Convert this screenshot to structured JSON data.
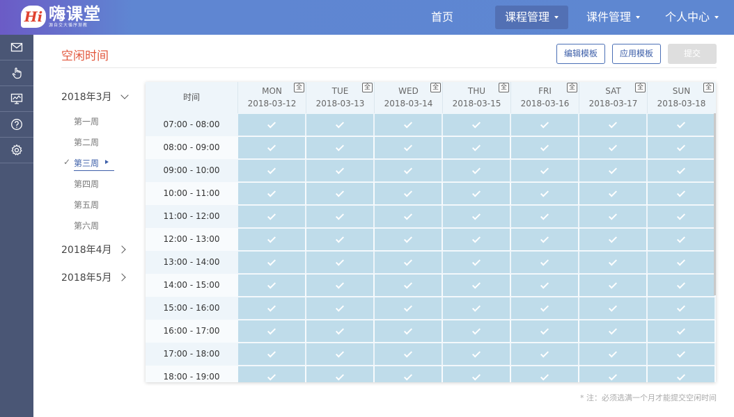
{
  "logo": {
    "badge": "Hi",
    "title": "嗨课堂",
    "subtitle": "源自交大循序渐教"
  },
  "nav": {
    "home": "首页",
    "course": "课程管理",
    "courseware": "课件管理",
    "personal": "个人中心"
  },
  "sidebar": {
    "items": [
      {
        "icon": "mail-icon"
      },
      {
        "icon": "hand-pointer-icon"
      },
      {
        "icon": "monitor-chart-icon"
      },
      {
        "icon": "help-icon"
      },
      {
        "icon": "settings-icon"
      }
    ]
  },
  "page": {
    "title": "空闲时间",
    "edit_template": "编辑模板",
    "apply_template": "应用模板",
    "submit": "提交",
    "note": "* 注：必须选满一个月才能提交空闲时间"
  },
  "months": [
    {
      "label": "2018年3月",
      "expanded": true
    },
    {
      "label": "2018年4月",
      "expanded": false
    },
    {
      "label": "2018年5月",
      "expanded": false
    }
  ],
  "weeks": [
    "第一周",
    "第二周",
    "第三周",
    "第四周",
    "第五周",
    "第六周"
  ],
  "week_check": "✓",
  "active_week_index": 2,
  "table": {
    "time_header": "时间",
    "all_label": "全",
    "days": [
      {
        "name": "MON",
        "date": "2018-03-12"
      },
      {
        "name": "TUE",
        "date": "2018-03-13"
      },
      {
        "name": "WED",
        "date": "2018-03-14"
      },
      {
        "name": "THU",
        "date": "2018-03-15"
      },
      {
        "name": "FRI",
        "date": "2018-03-16"
      },
      {
        "name": "SAT",
        "date": "2018-03-17"
      },
      {
        "name": "SUN",
        "date": "2018-03-18"
      }
    ],
    "slots": [
      "07:00 - 08:00",
      "08:00 - 09:00",
      "09:00 - 10:00",
      "10:00 - 11:00",
      "11:00 - 12:00",
      "12:00 - 13:00",
      "13:00 - 14:00",
      "14:00 - 15:00",
      "15:00 - 16:00",
      "16:00 - 17:00",
      "17:00 - 18:00",
      "18:00 - 19:00"
    ],
    "selected_color": "#bfdcea"
  },
  "colors": {
    "topbar": "#5e87d1",
    "sidebar": "#4a5675",
    "accent_title": "#e2573d",
    "link": "#3c5ea8"
  }
}
